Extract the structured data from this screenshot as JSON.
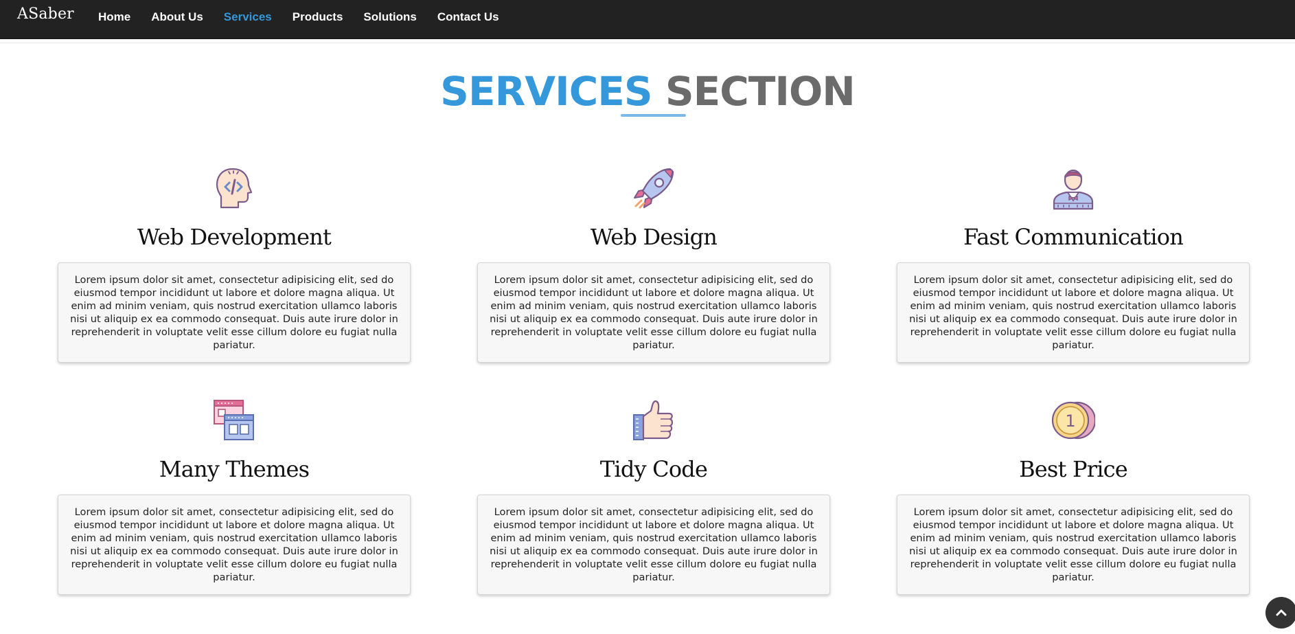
{
  "nav": {
    "brand": "ASaber",
    "links": [
      "Home",
      "About Us",
      "Services",
      "Products",
      "Solutions",
      "Contact Us"
    ],
    "active_index": 2
  },
  "section": {
    "title_part1": "SERVICES",
    "title_part2": "SECTION"
  },
  "services": [
    {
      "title": "Web Development",
      "icon": "coding-head-icon",
      "text": "Lorem ipsum dolor sit amet, consectetur adipisicing elit, sed do eiusmod tempor incididunt ut labore et dolore magna aliqua. Ut enim ad minim veniam, quis nostrud exercitation ullamco laboris nisi ut aliquip ex ea commodo consequat. Duis aute irure dolor in reprehenderit in voluptate velit esse cillum dolore eu fugiat nulla pariatur."
    },
    {
      "title": "Web Design",
      "icon": "rocket-icon",
      "text": "Lorem ipsum dolor sit amet, consectetur adipisicing elit, sed do eiusmod tempor incididunt ut labore et dolore magna aliqua. Ut enim ad minim veniam, quis nostrud exercitation ullamco laboris nisi ut aliquip ex ea commodo consequat. Duis aute irure dolor in reprehenderit in voluptate velit esse cillum dolore eu fugiat nulla pariatur."
    },
    {
      "title": "Fast Communication",
      "icon": "person-bowtie-icon",
      "text": "Lorem ipsum dolor sit amet, consectetur adipisicing elit, sed do eiusmod tempor incididunt ut labore et dolore magna aliqua. Ut enim ad minim veniam, quis nostrud exercitation ullamco laboris nisi ut aliquip ex ea commodo consequat. Duis aute irure dolor in reprehenderit in voluptate velit esse cillum dolore eu fugiat nulla pariatur."
    },
    {
      "title": "Many Themes",
      "icon": "windows-icon",
      "text": "Lorem ipsum dolor sit amet, consectetur adipisicing elit, sed do eiusmod tempor incididunt ut labore et dolore magna aliqua. Ut enim ad minim veniam, quis nostrud exercitation ullamco laboris nisi ut aliquip ex ea commodo consequat. Duis aute irure dolor in reprehenderit in voluptate velit esse cillum dolore eu fugiat nulla pariatur."
    },
    {
      "title": "Tidy Code",
      "icon": "thumbs-up-icon",
      "text": "Lorem ipsum dolor sit amet, consectetur adipisicing elit, sed do eiusmod tempor incididunt ut labore et dolore magna aliqua. Ut enim ad minim veniam, quis nostrud exercitation ullamco laboris nisi ut aliquip ex ea commodo consequat. Duis aute irure dolor in reprehenderit in voluptate velit esse cillum dolore eu fugiat nulla pariatur."
    },
    {
      "title": "Best Price",
      "icon": "coin-icon",
      "coin_label": "1",
      "text": "Lorem ipsum dolor sit amet, consectetur adipisicing elit, sed do eiusmod tempor incididunt ut labore et dolore magna aliqua. Ut enim ad minim veniam, quis nostrud exercitation ullamco laboris nisi ut aliquip ex ea commodo consequat. Duis aute irure dolor in reprehenderit in voluptate velit esse cillum dolore eu fugiat nulla pariatur."
    }
  ],
  "scroll_top": {
    "icon": "chevron-up-icon"
  },
  "colors": {
    "accent": "#3498db",
    "navbar": "#222222",
    "title_gray": "#6b6b6b",
    "card_bg": "#f7f7f7"
  }
}
